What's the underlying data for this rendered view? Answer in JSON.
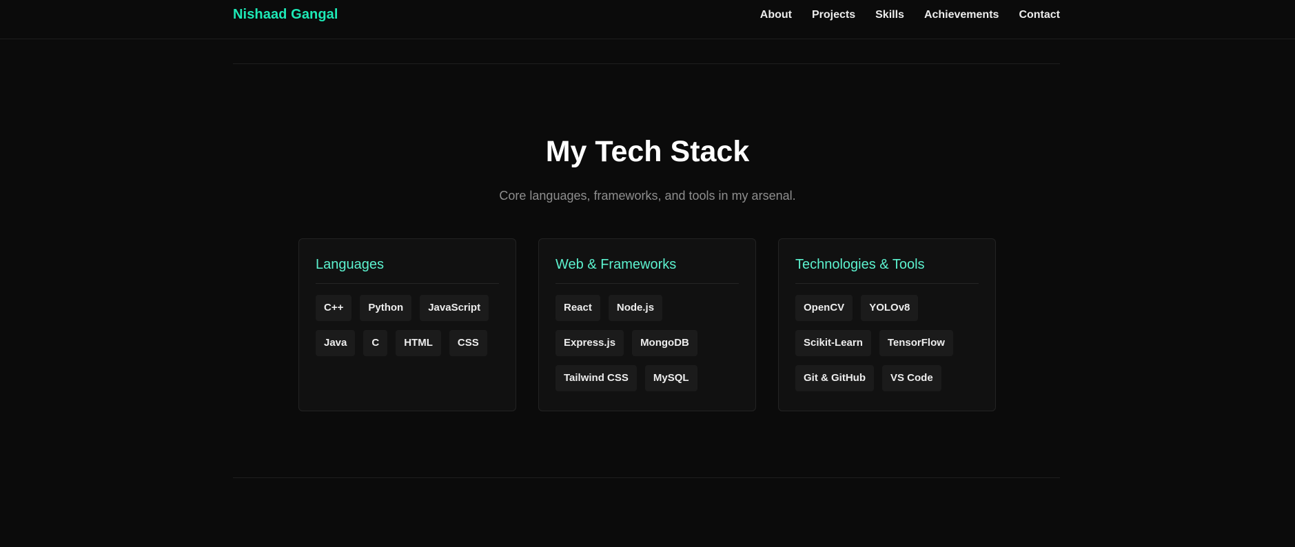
{
  "header": {
    "brand": "Nishaad Gangal",
    "nav": [
      "About",
      "Projects",
      "Skills",
      "Achievements",
      "Contact"
    ]
  },
  "section": {
    "title": "My Tech Stack",
    "subtitle": "Core languages, frameworks, and tools in my arsenal."
  },
  "cards": [
    {
      "title": "Languages",
      "items": [
        "C++",
        "Python",
        "JavaScript",
        "Java",
        "C",
        "HTML",
        "CSS"
      ]
    },
    {
      "title": "Web & Frameworks",
      "items": [
        "React",
        "Node.js",
        "Express.js",
        "MongoDB",
        "Tailwind CSS",
        "MySQL"
      ]
    },
    {
      "title": "Technologies & Tools",
      "items": [
        "OpenCV",
        "YOLOv8",
        "Scikit-Learn",
        "TensorFlow",
        "Git & GitHub",
        "VS Code"
      ]
    }
  ],
  "colors": {
    "background": "#0b0b0b",
    "accent": "#1de9b6",
    "card_title": "#5cf2cf",
    "card_background": "#111111",
    "chip_background": "#1b1b1b",
    "muted_text": "#8e8e8e"
  }
}
